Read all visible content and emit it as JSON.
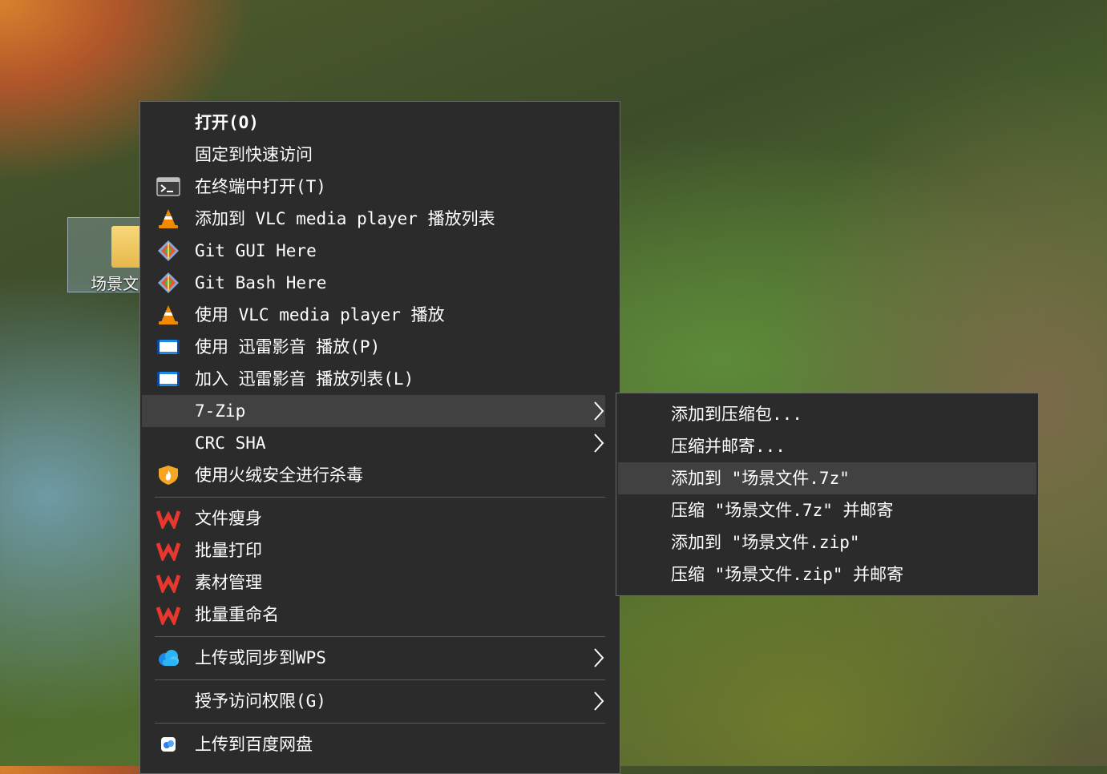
{
  "desktop": {
    "folder_label": "场景文"
  },
  "menu": {
    "items": [
      {
        "label": "打开(O)"
      },
      {
        "label": "固定到快速访问"
      },
      {
        "label": "在终端中打开(T)"
      },
      {
        "label": "添加到 VLC media player 播放列表"
      },
      {
        "label": "Git GUI Here"
      },
      {
        "label": "Git Bash Here"
      },
      {
        "label": "使用 VLC media player 播放"
      },
      {
        "label": "使用 迅雷影音 播放(P)"
      },
      {
        "label": "加入 迅雷影音 播放列表(L)"
      },
      {
        "label": "7-Zip"
      },
      {
        "label": "CRC SHA"
      },
      {
        "label": "使用火绒安全进行杀毒"
      },
      {
        "label": "文件瘦身"
      },
      {
        "label": "批量打印"
      },
      {
        "label": "素材管理"
      },
      {
        "label": "批量重命名"
      },
      {
        "label": "上传或同步到WPS"
      },
      {
        "label": "授予访问权限(G)"
      },
      {
        "label": "上传到百度网盘"
      }
    ]
  },
  "submenu": {
    "items": [
      {
        "label": "添加到压缩包..."
      },
      {
        "label": "压缩并邮寄..."
      },
      {
        "label": "添加到 \"场景文件.7z\""
      },
      {
        "label": "压缩 \"场景文件.7z\" 并邮寄"
      },
      {
        "label": "添加到 \"场景文件.zip\""
      },
      {
        "label": "压缩 \"场景文件.zip\" 并邮寄"
      }
    ]
  },
  "colors": {
    "menu_bg": "#2b2b2b",
    "highlight_bg": "#414141",
    "text": "#ffffff",
    "vlc_orange": "#f08a00",
    "wps_red": "#e8382e"
  },
  "icons": {
    "terminal": "terminal-icon",
    "vlc": "vlc-cone-icon",
    "git": "git-icon",
    "xunlei": "xunlei-player-icon",
    "huorong": "huorong-shield-icon",
    "wps": "wps-icon",
    "wps_cloud": "wps-cloud-icon",
    "baidu": "baidu-netdisk-icon",
    "chevron": "chevron-right-icon"
  }
}
